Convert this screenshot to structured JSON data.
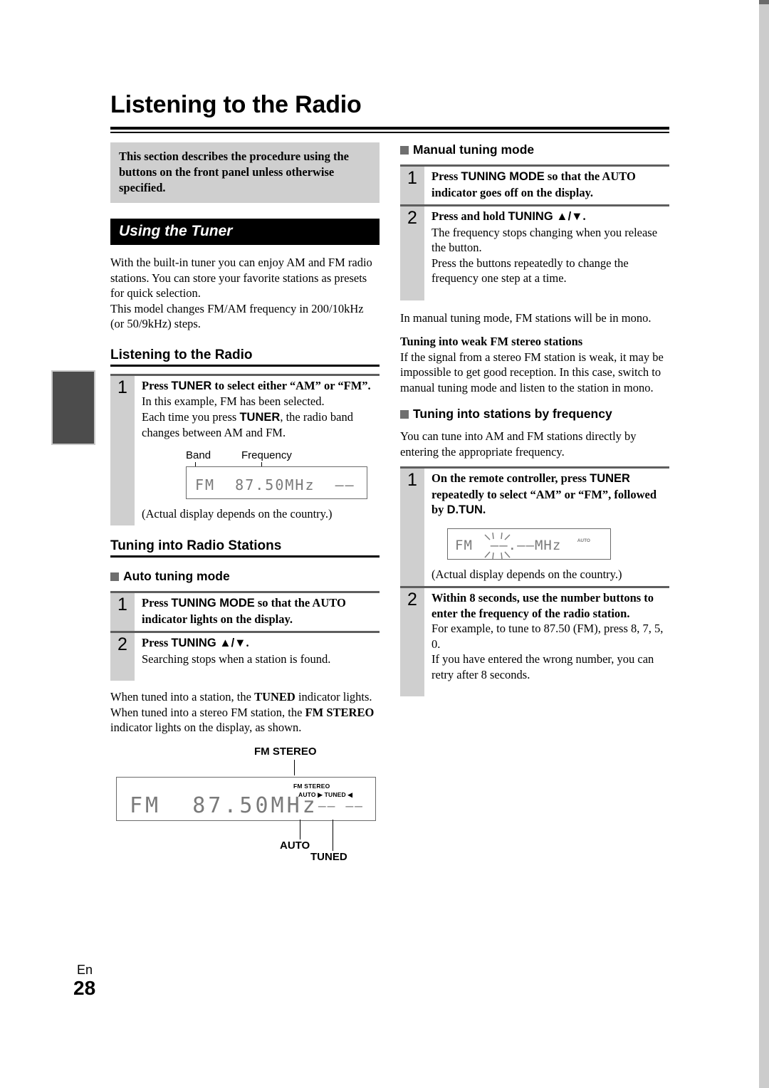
{
  "page": {
    "title": "Listening to the Radio",
    "footer_lang": "En",
    "footer_number": "28"
  },
  "left": {
    "note_box": "This section describes the procedure using the buttons on the front panel unless otherwise specified.",
    "banner": "Using the Tuner",
    "intro_p1": "With the built-in tuner you can enjoy AM and FM radio stations. You can store your favorite stations as presets for quick selection.",
    "intro_p2": "This model changes FM/AM frequency in 200/10kHz (or 50/9kHz) steps.",
    "h2_listening": "Listening to the Radio",
    "step_tuner": {
      "number": "1",
      "lead_a": "Press ",
      "lead_b": "TUNER",
      "lead_c": " to select either “AM” or “FM”.",
      "body_1": "In this example, FM has been selected.",
      "body_2a": "Each time you press ",
      "body_2b": "TUNER",
      "body_2c": ", the radio band changes between AM and FM.",
      "callout_band": "Band",
      "callout_frequency": "Frequency",
      "lcd_text": "FM  87.50MHz  ––",
      "caption": "(Actual display depends on the country.)"
    },
    "h2_tuning": "Tuning into Radio Stations",
    "auto_head": "Auto tuning mode",
    "auto_steps": [
      {
        "number": "1",
        "lead_a": "Press ",
        "lead_b": "TUNING MODE",
        "lead_c": " so that the AUTO indicator lights on the display.",
        "body": ""
      },
      {
        "number": "2",
        "lead_a": "Press ",
        "lead_b": "TUNING ▲/▼",
        "lead_c": ".",
        "body": "Searching stops when a station is found."
      }
    ],
    "tuned_note_a": "When tuned into a station, the ",
    "tuned_note_b": "TUNED",
    "tuned_note_c": " indicator lights. When tuned into a stereo FM station, the ",
    "tuned_note_d": "FM STEREO",
    "tuned_note_e": " indicator lights on the display, as shown.",
    "display_labels": {
      "fm_stereo": "FM STEREO",
      "auto": "AUTO",
      "tuned": "TUNED"
    },
    "lcd_big": {
      "text": "FM  87.50MHz",
      "tail": "–– ––",
      "ind_fm_stereo": "FM STEREO",
      "ind_row": "AUTO  ▶ TUNED ◀"
    }
  },
  "right": {
    "manual_head": "Manual tuning mode",
    "manual_steps": [
      {
        "number": "1",
        "lead_a": "Press ",
        "lead_b": "TUNING MODE",
        "lead_c": " so that the AUTO indicator goes off on the display.",
        "body": ""
      },
      {
        "number": "2",
        "lead_a": "Press and hold ",
        "lead_b": "TUNING ▲/▼",
        "lead_c": ".",
        "body_1": "The frequency stops changing when you release the button.",
        "body_2": "Press the buttons repeatedly to change the frequency one step at a time."
      }
    ],
    "mono_note": "In manual tuning mode, FM stations will be in mono.",
    "weak_head": "Tuning into weak FM stereo stations",
    "weak_body": "If the signal from a stereo FM station is weak, it may be impossible to get good reception. In this case, switch to manual tuning mode and listen to the station in mono.",
    "freq_head": "Tuning into stations by frequency",
    "freq_intro": "You can tune into AM and FM stations directly by entering the appropriate frequency.",
    "freq_steps": [
      {
        "number": "1",
        "lead_a": "On the remote controller, press ",
        "lead_b": "TUNER",
        "lead_c": " repeatedly to select “AM” or “FM”, followed by ",
        "lead_d": "D.TUN",
        "lead_e": ".",
        "lcd_text": "FM  ––.––MHz",
        "lcd_auto": "AUTO",
        "caption": "(Actual display depends on the country.)"
      },
      {
        "number": "2",
        "lead": "Within 8 seconds, use the number buttons to enter the frequency of the radio station.",
        "body_1": "For example, to tune to 87.50 (FM), press 8, 7, 5, 0.",
        "body_2": "If you have entered the wrong number, you can retry after 8 seconds."
      }
    ]
  }
}
